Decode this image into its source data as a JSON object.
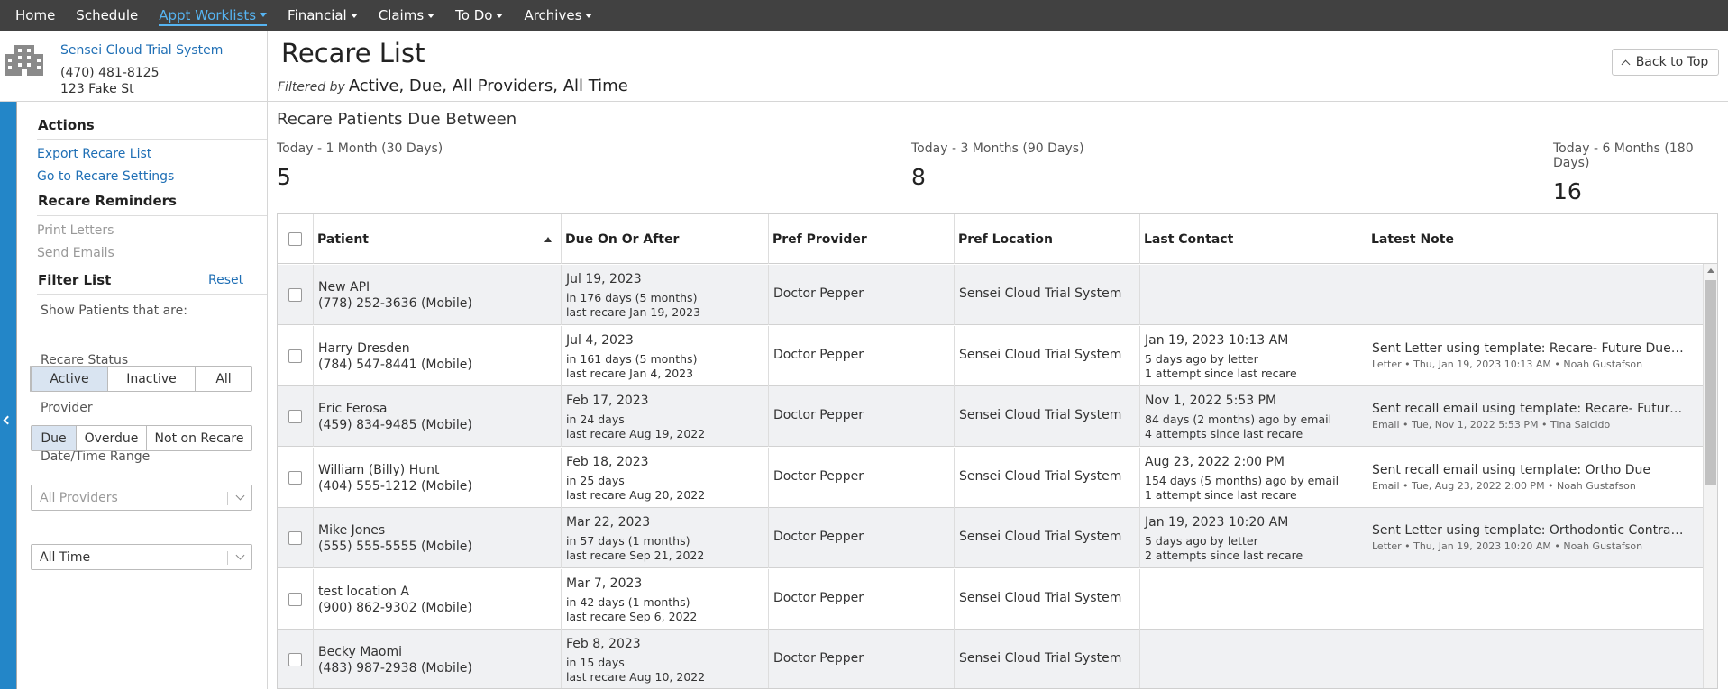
{
  "nav": {
    "home": "Home",
    "schedule": "Schedule",
    "appt_worklists": "Appt Worklists",
    "financial": "Financial",
    "claims": "Claims",
    "todo": "To Do",
    "archives": "Archives"
  },
  "office": {
    "name": "Sensei Cloud Trial System",
    "phone": "(470) 481-8125",
    "address": "123 Fake St"
  },
  "page": {
    "title": "Recare List",
    "filtered_by_label": "Filtered by",
    "filtered_by_value": "Active, Due, All Providers, All Time",
    "back_to_top": "Back to Top"
  },
  "sidebar": {
    "actions_title": "Actions",
    "export": "Export Recare List",
    "settings": "Go to Recare Settings",
    "reminders_title": "Recare Reminders",
    "print_letters": "Print Letters",
    "send_emails": "Send Emails",
    "filter_title": "Filter List",
    "reset": "Reset",
    "show_label": "Show Patients that are:",
    "status_options": [
      "Active",
      "Inactive",
      "All"
    ],
    "recare_status_label": "Recare Status",
    "recare_options": [
      "Due",
      "Overdue",
      "Not on Recare"
    ],
    "provider_label": "Provider",
    "provider_value": "All Providers",
    "range_label": "Date/Time Range",
    "range_value": "All Time"
  },
  "summary": {
    "title": "Recare Patients Due Between",
    "stats": [
      {
        "range": "Today - 1 Month (30 Days)",
        "count": "5"
      },
      {
        "range": "Today - 3 Months (90 Days)",
        "count": "8"
      },
      {
        "range": "Today - 6 Months (180 Days)",
        "count": "16"
      }
    ]
  },
  "table": {
    "headers": [
      "Patient",
      "Due On Or After",
      "Pref Provider",
      "Pref Location",
      "Last Contact",
      "Latest Note"
    ],
    "rows": [
      {
        "name": "New API",
        "phone": "(778) 252-3636 (Mobile)",
        "due": "Jul 19, 2023",
        "due_in": "in 176 days (5 months)",
        "last_recare": "last recare Jan 19, 2023",
        "provider": "Doctor Pepper",
        "location": "Sensei Cloud Trial System",
        "contact": "",
        "contact_ago": "",
        "contact_attempts": "",
        "note": "",
        "note_meta": ""
      },
      {
        "name": "Harry Dresden",
        "phone": "(784) 547-8441 (Mobile)",
        "due": "Jul 4, 2023",
        "due_in": "in 161 days (5 months)",
        "last_recare": "last recare Jan 4, 2023",
        "provider": "Doctor Pepper",
        "location": "Sensei Cloud Trial System",
        "contact": "Jan 19, 2023 10:13 AM",
        "contact_ago": "5 days ago by letter",
        "contact_attempts": "1 attempt since last recare",
        "note": "Sent Letter using template: Recare- Future Due -Lett...",
        "note_meta": "Letter • Thu, Jan 19, 2023 10:13 AM • Noah Gustafson"
      },
      {
        "name": "Eric Ferosa",
        "phone": "(459) 834-9485 (Mobile)",
        "due": "Feb 17, 2023",
        "due_in": "in 24 days",
        "last_recare": "last recare Aug 19, 2022",
        "provider": "Doctor Pepper",
        "location": "Sensei Cloud Trial System",
        "contact": "Nov 1, 2022 5:53 PM",
        "contact_ago": "84 days (2 months) ago by email",
        "contact_attempts": "4 attempts since last recare",
        "note": "Sent recall email using template: Recare- Future Due",
        "note_meta": "Email • Tue, Nov 1, 2022 5:53 PM • Tina Salcido"
      },
      {
        "name": "William (Billy) Hunt",
        "phone": "(404) 555-1212 (Mobile)",
        "due": "Feb 18, 2023",
        "due_in": "in 25 days",
        "last_recare": "last recare Aug 20, 2022",
        "provider": "Doctor Pepper",
        "location": "Sensei Cloud Trial System",
        "contact": "Aug 23, 2022 2:00 PM",
        "contact_ago": "154 days (5 months) ago by email",
        "contact_attempts": "1 attempt since last recare",
        "note": "Sent recall email using template: Ortho Due",
        "note_meta": "Email • Tue, Aug 23, 2022 2:00 PM • Noah Gustafson"
      },
      {
        "name": "Mike Jones",
        "phone": "(555) 555-5555 (Mobile)",
        "due": "Mar 22, 2023",
        "due_in": "in 57 days (1 months)",
        "last_recare": "last recare Sep 21, 2022",
        "provider": "Doctor Pepper",
        "location": "Sensei Cloud Trial System",
        "contact": "Jan 19, 2023 10:20 AM",
        "contact_ago": "5 days ago by letter",
        "contact_attempts": "2 attempts since last recare",
        "note": "Sent Letter using template: Orthodontic Contract at ...",
        "note_meta": "Letter • Thu, Jan 19, 2023 10:20 AM • Noah Gustafson"
      },
      {
        "name": "test location A",
        "phone": "(900) 862-9302 (Mobile)",
        "due": "Mar 7, 2023",
        "due_in": "in 42 days (1 months)",
        "last_recare": "last recare Sep 6, 2022",
        "provider": "Doctor Pepper",
        "location": "Sensei Cloud Trial System",
        "contact": "",
        "contact_ago": "",
        "contact_attempts": "",
        "note": "",
        "note_meta": ""
      },
      {
        "name": "Becky Maomi",
        "phone": "(483) 987-2938 (Mobile)",
        "due": "Feb 8, 2023",
        "due_in": "in 15 days",
        "last_recare": "last recare Aug 10, 2022",
        "provider": "Doctor Pepper",
        "location": "Sensei Cloud Trial System",
        "contact": "",
        "contact_ago": "",
        "contact_attempts": "",
        "note": "",
        "note_meta": ""
      }
    ]
  }
}
